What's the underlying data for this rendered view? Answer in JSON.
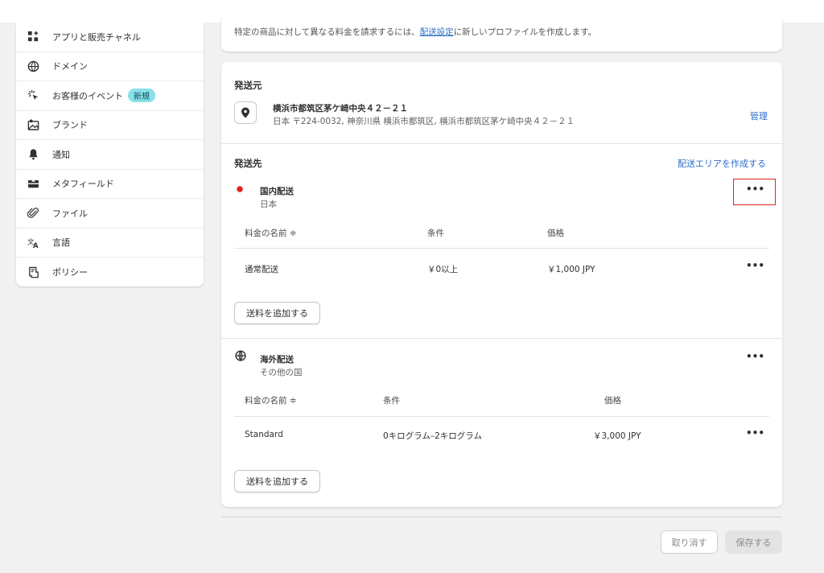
{
  "sidebar": {
    "items": [
      {
        "label": "アプリと販売チャネル",
        "icon": "apps-icon"
      },
      {
        "label": "ドメイン",
        "icon": "globe-icon"
      },
      {
        "label": "お客様のイベント",
        "icon": "cursor-click-icon",
        "badge": "新規"
      },
      {
        "label": "ブランド",
        "icon": "brand-icon"
      },
      {
        "label": "通知",
        "icon": "bell-icon"
      },
      {
        "label": "メタフィールド",
        "icon": "metafield-icon"
      },
      {
        "label": "ファイル",
        "icon": "paperclip-icon"
      },
      {
        "label": "言語",
        "icon": "language-icon"
      },
      {
        "label": "ポリシー",
        "icon": "policy-icon"
      }
    ]
  },
  "info": {
    "text_before": "特定の商品に対して異なる料金を請求するには、",
    "link": "配送設定",
    "text_after": "に新しいプロファイルを作成します。"
  },
  "origin": {
    "title": "発送元",
    "name": "横浜市都筑区茅ケ崎中央４２－２１",
    "address": "日本 〒224-0032, 神奈川県 横浜市都筑区, 横浜市都筑区茅ケ崎中央４２－２１",
    "manage_link": "管理"
  },
  "destination": {
    "title": "発送先",
    "create_zone_link": "配送エリアを作成する",
    "zones": [
      {
        "name": "国内配送",
        "sub": "日本",
        "headers": [
          "料金の名前 ≑",
          "条件",
          "価格"
        ],
        "rows": [
          {
            "name": "通常配送",
            "condition": "￥0以上",
            "price": "￥1,000 JPY"
          }
        ],
        "add_rate": "送料を追加する"
      },
      {
        "name": "海外配送",
        "sub": "その他の国",
        "headers": [
          "料金の名前 ≑",
          "条件",
          "価格"
        ],
        "rows": [
          {
            "name": "Standard",
            "condition": "0キログラム–2キログラム",
            "price": "￥3,000 JPY"
          }
        ],
        "add_rate": "送料を追加する"
      }
    ]
  },
  "more_label": "•••",
  "footer": {
    "cancel": "取り消す",
    "save": "保存する"
  },
  "colors": {
    "accent": "#2c6ecb",
    "domestic_dot": "#e02424",
    "highlight": "#e02424"
  }
}
